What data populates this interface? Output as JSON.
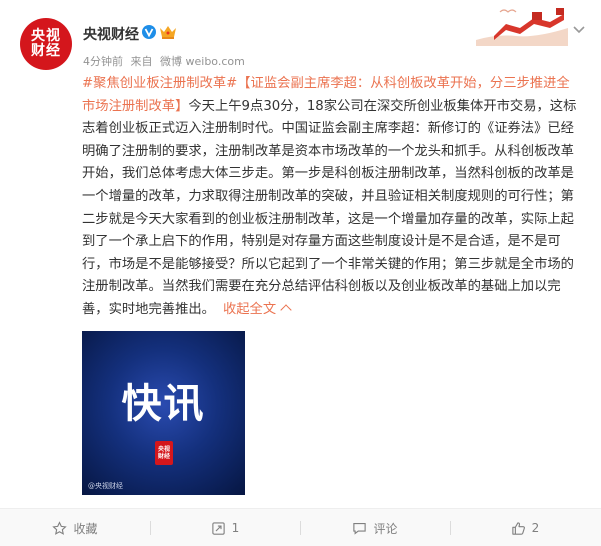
{
  "header": {
    "avatar_line1": "央视",
    "avatar_line2": "财经",
    "author": "央视财经",
    "time": "4分钟前",
    "source_prefix": "来自",
    "source": "微博 weibo.com"
  },
  "post": {
    "hashtag": "#聚焦创业板注册制改革#",
    "title": "【证监会副主席李超：从科创板改革开始，分三步推进全市场注册制改革】",
    "body": "今天上午9点30分，18家公司在深交所创业板集体开市交易，这标志着创业板正式迈入注册制时代。中国证监会副主席李超：新修订的《证券法》已经明确了注册制的要求，注册制改革是资本市场改革的一个龙头和抓手。从科创板改革开始，我们总体考虑大体三步走。第一步是科创板注册制改革，当然科创板的改革是一个增量的改革，力求取得注册制改革的突破，并且验证相关制度规则的可行性；第二步就是今天大家看到的创业板注册制改革，这是一个增量加存量的改革，实际上起到了一个承上启下的作用，特别是对存量方面这些制度设计是不是合适，是不是可行，市场是不是能够接受？所以它起到了一个非常关键的作用；第三步就是全市场的注册制改革。当然我们需要在充分总结评估科创板以及创业板改革的基础上加以完善，实时地完善推出。",
    "collapse_label": "收起全文"
  },
  "image": {
    "headline": "快讯",
    "logo_line1": "央视",
    "logo_line2": "财经",
    "watermark": "@央视财经"
  },
  "actions": {
    "favorite": "收藏",
    "repost": "1",
    "comment": "评论",
    "like": "2"
  },
  "colors": {
    "accent": "#eb7350",
    "brand_red": "#d4161c",
    "verified_blue": "#1e8ee8"
  }
}
